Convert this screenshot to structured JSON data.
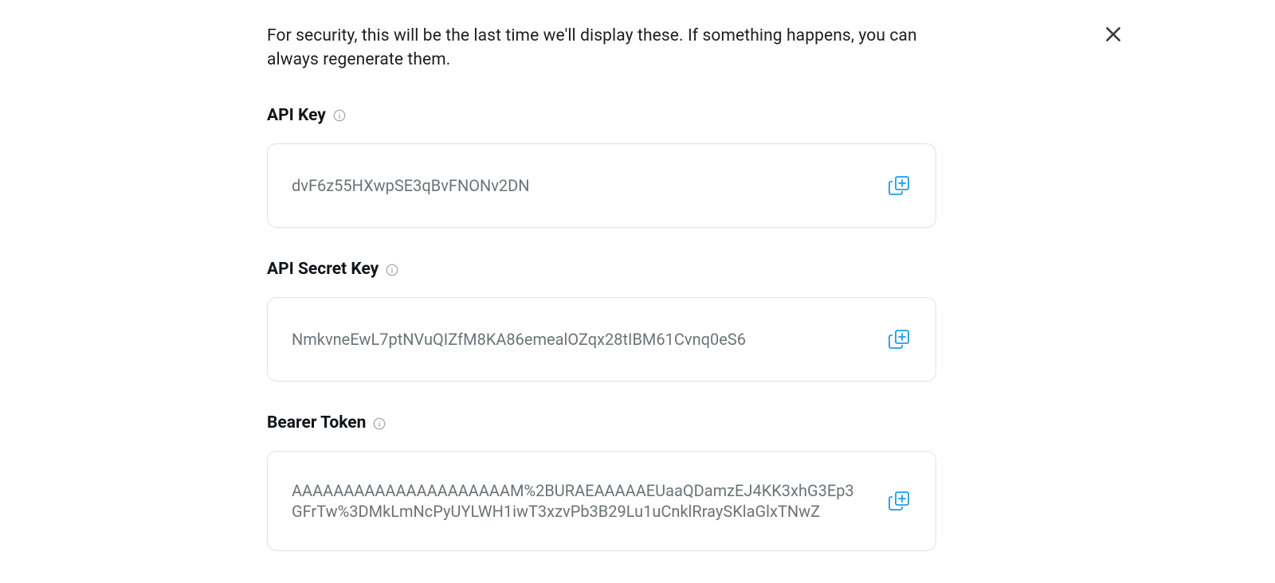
{
  "intro": "For security, this will be the last time we'll display these. If something happens, you can always regenerate them.",
  "fields": {
    "api_key": {
      "label": "API Key",
      "value": "dvF6z55HXwpSE3qBvFNONv2DN"
    },
    "api_secret_key": {
      "label": "API Secret Key",
      "value": "NmkvneEwL7ptNVuQIZfM8KA86emealOZqx28tIBM61Cvnq0eS6"
    },
    "bearer_token": {
      "label": "Bearer Token",
      "value": "AAAAAAAAAAAAAAAAAAAAAM%2BURAEAAAAAEUaaQDamzEJ4KK3xhG3Ep3GFrTw%3DMkLmNcPyUYLWH1iwT3xzvPb3B29Lu1uCnklRraySKlaGlxTNwZ"
    }
  },
  "icons": {
    "info": "info-icon",
    "copy": "copy-icon",
    "close": "close-icon"
  },
  "colors": {
    "accent": "#1d9bf0",
    "muted_text": "#6b7378",
    "border": "#dfe3e6"
  }
}
